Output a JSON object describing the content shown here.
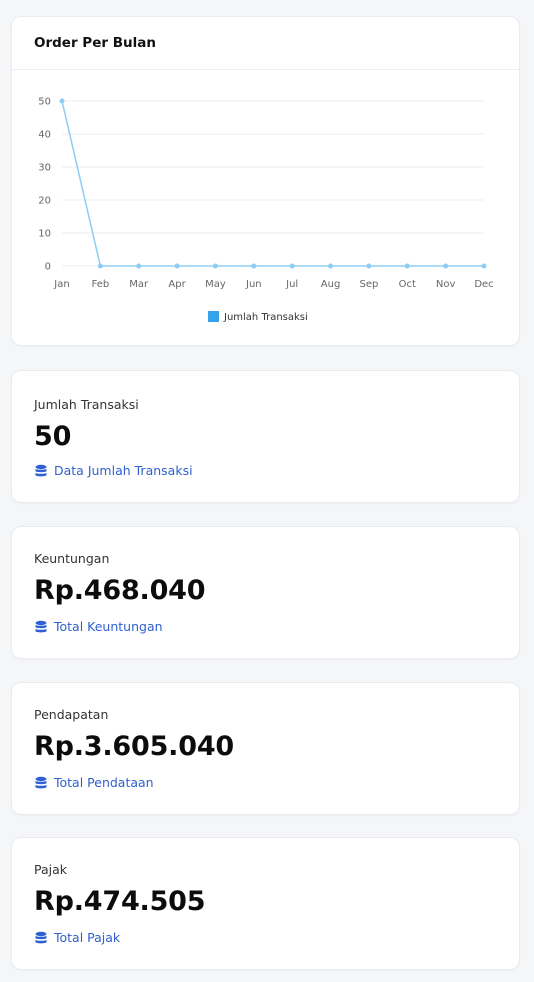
{
  "chart_card": {
    "title": "Order Per Bulan"
  },
  "chart_data": {
    "type": "line",
    "categories": [
      "Jan",
      "Feb",
      "Mar",
      "Apr",
      "May",
      "Jun",
      "Jul",
      "Aug",
      "Sep",
      "Oct",
      "Nov",
      "Dec"
    ],
    "series": [
      {
        "name": "Jumlah Transaksi",
        "values": [
          50,
          0,
          0,
          0,
          0,
          0,
          0,
          0,
          0,
          0,
          0,
          0
        ],
        "color": "#8ecdf3"
      }
    ],
    "y_ticks": [
      "0",
      "10",
      "20",
      "30",
      "40",
      "50"
    ],
    "ylim": [
      0,
      50
    ],
    "grid": true,
    "legend": "bottom-center",
    "legend_swatch_color": "#36a2eb"
  },
  "stats": [
    {
      "label": "Jumlah Transaksi",
      "value": "50",
      "link": "Data Jumlah Transaksi",
      "icon": "database-icon"
    },
    {
      "label": "Keuntungan",
      "value": "Rp.468.040",
      "link": "Total Keuntungan",
      "icon": "database-icon"
    },
    {
      "label": "Pendapatan",
      "value": "Rp.3.605.040",
      "link": "Total Pendataan",
      "icon": "database-icon"
    },
    {
      "label": "Pajak",
      "value": "Rp.474.505",
      "link": "Total Pajak",
      "icon": "database-icon"
    }
  ],
  "colors": {
    "accent_link": "#2f5fd0",
    "line": "#8ecdf3"
  }
}
